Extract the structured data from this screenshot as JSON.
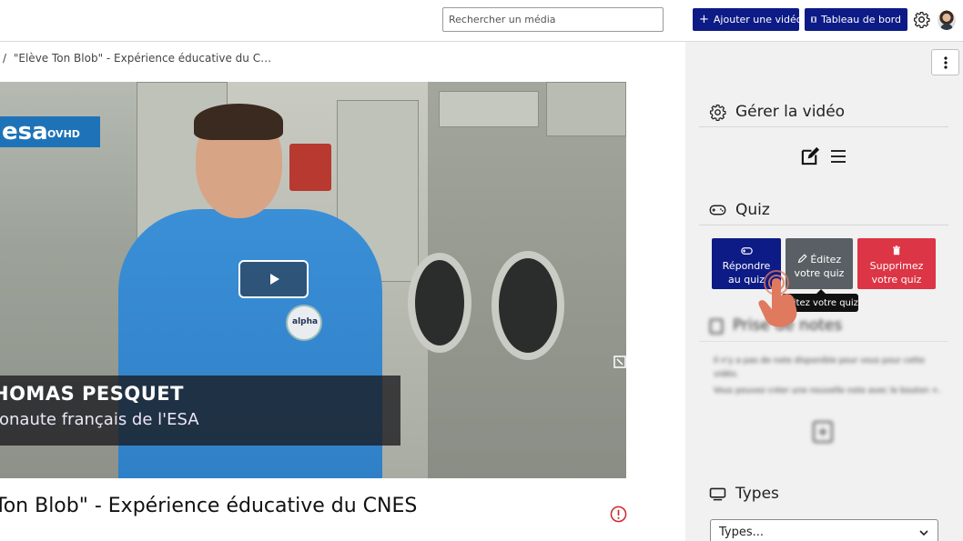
{
  "header": {
    "search_placeholder": "Rechercher un média",
    "add_video_label": "Ajouter une vidéo",
    "dashboard_label": "Tableau de bord",
    "brand_color": "#0d1b86"
  },
  "breadcrumb": {
    "separator": "/",
    "current": "\"Elève Ton Blob\" - Expérience éducative du C…"
  },
  "video": {
    "logo_text": "esa",
    "logo_subtext": "OVHD",
    "lower_third_name": "HOMAS PESQUET",
    "lower_third_role": "ronaute français de l'ESA",
    "patch_text": "alpha",
    "title": "Ton Blob\" - Expérience éducative du CNES"
  },
  "sidebar": {
    "manage_title": "Gérer la vidéo",
    "quiz_title": "Quiz",
    "quiz_buttons": [
      {
        "label": "Répondre au quiz",
        "icon": "gamepad-icon",
        "color": "#0d1b86"
      },
      {
        "label": "Éditez votre quiz",
        "icon": "pencil-icon",
        "color": "#595f64"
      },
      {
        "label": "Supprimez votre quiz",
        "icon": "trash-icon",
        "color": "#dc3545"
      }
    ],
    "tooltip": "Éditez votre quiz",
    "notes_title": "Prise de notes",
    "notes_text_1": "Il n'y a pas de note disponible pour vous pour cette vidéo.",
    "notes_text_2": "Vous pouvez créer une nouvelle note avec le bouton +.",
    "types_title": "Types",
    "types_select_value": "Types..."
  }
}
